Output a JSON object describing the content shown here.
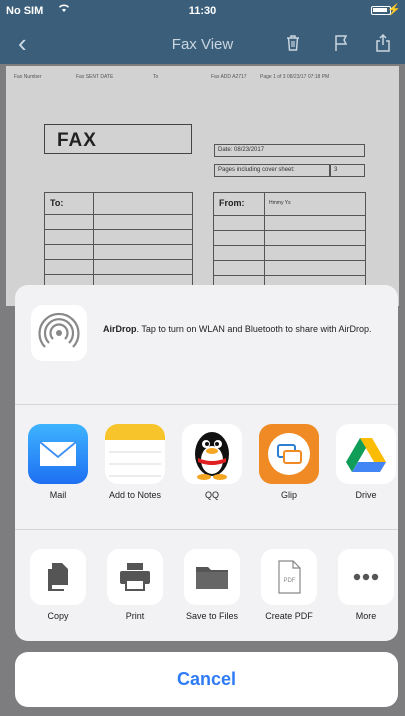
{
  "status_bar": {
    "carrier": "No SIM",
    "time": "11:30"
  },
  "nav": {
    "title": "Fax View"
  },
  "document": {
    "header": [
      "Fax Number",
      "Fax SENT DATE",
      "To",
      "Fax ADD A2717",
      "Page 1 of 3 08/23/17 07:18 PM"
    ],
    "fax_title": "FAX",
    "date_label": "Date:",
    "date_value": "08/23/2017",
    "pages_label": "Pages including cover sheet:",
    "pages_value": "3",
    "to_label": "To:",
    "from_label": "From:",
    "from_value": "Hmmy Ys"
  },
  "share_sheet": {
    "airdrop": {
      "title": "AirDrop",
      "description": ". Tap to turn on WLAN and Bluetooth to share with AirDrop."
    },
    "apps": [
      {
        "label": "Mail",
        "icon": "mail-icon"
      },
      {
        "label": "Add to Notes",
        "icon": "notes-icon"
      },
      {
        "label": "QQ",
        "icon": "qq-penguin-icon"
      },
      {
        "label": "Glip",
        "icon": "glip-icon"
      },
      {
        "label": "Drive",
        "icon": "google-drive-icon"
      }
    ],
    "actions": [
      {
        "label": "Copy",
        "icon": "copy-icon"
      },
      {
        "label": "Print",
        "icon": "printer-icon"
      },
      {
        "label": "Save to Files",
        "icon": "folder-icon"
      },
      {
        "label": "Create PDF",
        "icon": "pdf-icon"
      },
      {
        "label": "More",
        "icon": "more-icon"
      }
    ],
    "pdf_badge": "PDF"
  },
  "cancel_label": "Cancel",
  "colors": {
    "nav_bar": "#3b5f7a",
    "accent": "#2e7bf6",
    "sheet_bg": "#f2f2f4"
  }
}
